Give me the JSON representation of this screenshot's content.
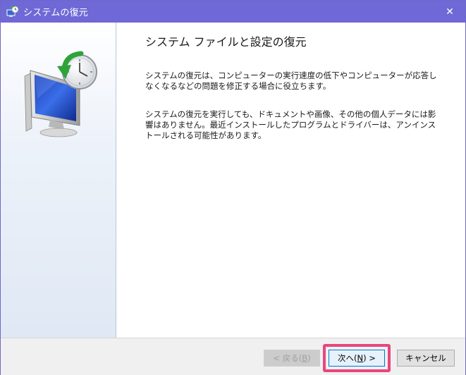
{
  "window": {
    "title": "システムの復元",
    "close_glyph": "✕"
  },
  "content": {
    "heading": "システム ファイルと設定の復元",
    "paragraph1": "システムの復元は、コンピューターの実行速度の低下やコンピューターが応答しなくなるなどの問題を修正する場合に役立ちます。",
    "paragraph2": "システムの復元を実行しても、ドキュメントや画像、その他の個人データには影響はありません。最近インストールしたプログラムとドライバーは、アンインストールされる可能性があります。"
  },
  "footer": {
    "back_label_pre": "< 戻る(",
    "back_key": "B",
    "back_label_post": ")",
    "next_label_pre": "次へ(",
    "next_key": "N",
    "next_label_post": ") >",
    "cancel_label": "キャンセル"
  },
  "colors": {
    "titlebar": "#6e69d6",
    "highlight": "#e8467c",
    "next_border": "#0078d7"
  },
  "icons": {
    "title": "system-restore-icon",
    "hero": "monitor-clock-restore-icon",
    "close": "close-icon"
  }
}
